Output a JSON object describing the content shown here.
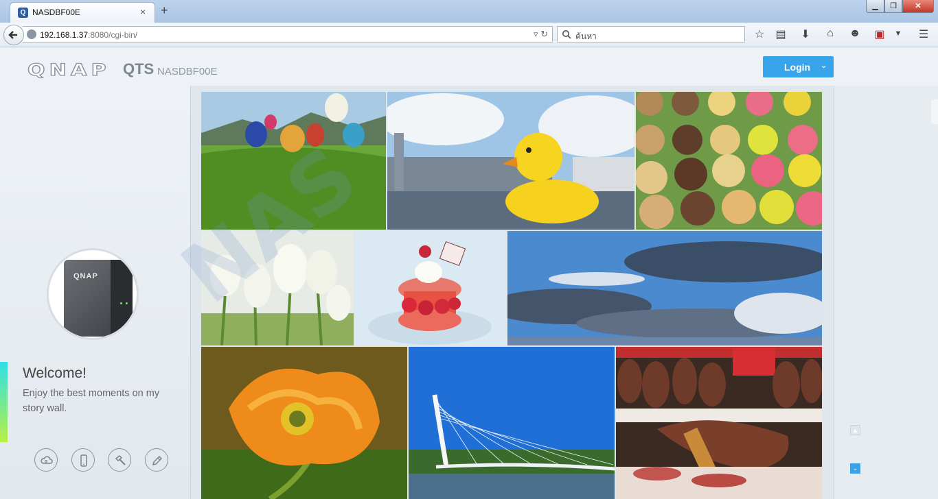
{
  "browser": {
    "tab_title": "NASDBF00E",
    "tab_close": "×",
    "new_tab": "+",
    "url_host": "192.168.1.37",
    "url_rest": ":8080/cgi-bin/",
    "search_placeholder": "ค้นหา",
    "window_min": "▁",
    "window_max": "❐",
    "window_close": "✕",
    "icons": [
      "star-icon",
      "reading-list-icon",
      "download-icon",
      "home-icon",
      "chat-icon",
      "pdf-icon",
      "menu-dropdown-icon",
      "hamburger-icon"
    ]
  },
  "header": {
    "logo_text": "QNAP",
    "product": "QTS",
    "hostname": "NASDBF00E",
    "login_label": "Login",
    "login_caret": "⌄",
    "login_color": "#37a4ec"
  },
  "sidebar": {
    "device_logo": "QNAP",
    "welcome_title": "Welcome!",
    "welcome_text": "Enjoy the best moments on my story wall.",
    "buttons": [
      "cloud-icon",
      "mobile-icon",
      "hammer-icon",
      "pencil-icon"
    ],
    "accent_colors": [
      "#2de0e6",
      "#b8f046"
    ]
  },
  "photos": [
    {
      "name": "photo-hot-air-balloons"
    },
    {
      "name": "photo-rubber-duck"
    },
    {
      "name": "photo-macarons"
    },
    {
      "name": "photo-tulips"
    },
    {
      "name": "photo-macaron-dessert"
    },
    {
      "name": "photo-cloudy-sky"
    },
    {
      "name": "photo-orange-poppy"
    },
    {
      "name": "photo-cable-bridge"
    },
    {
      "name": "photo-ham-market"
    }
  ],
  "scroll": {
    "up": "▲",
    "down": "⌄"
  }
}
